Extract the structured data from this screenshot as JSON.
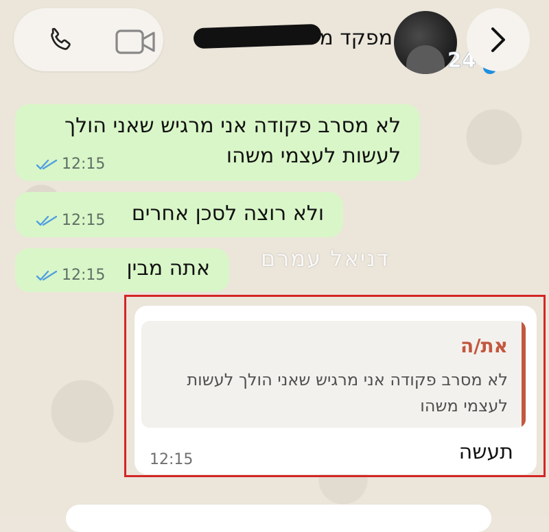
{
  "header": {
    "contact_name": "מפקד מ",
    "call_icon": "phone-icon",
    "video_icon": "video-camera-icon",
    "back_icon": "chevron-right-icon",
    "logo_text": "24"
  },
  "messages": [
    {
      "lines": [
        "לא מסרב פקודה אני מרגיש שאני הולך",
        "לעשות לעצמי משהו"
      ],
      "time": "12:15",
      "status": "read"
    },
    {
      "lines": [
        "ולא רוצה לסכן אחרים"
      ],
      "time": "12:15",
      "status": "read"
    },
    {
      "lines": [
        "אתה מבין"
      ],
      "time": "12:15",
      "status": "read"
    }
  ],
  "watermark": "דניאל עמרם",
  "reply": {
    "quoted_author": "את/ה",
    "quoted_lines": [
      "לא מסרב פקודה אני מרגיש שאני הולך לעשות",
      "לעצמי משהו"
    ],
    "text": "תעשה",
    "time": "12:15"
  },
  "colors": {
    "outgoing_bubble": "#d9f6c8",
    "incoming_bubble": "#ffffff",
    "quote_accent": "#c2583f",
    "read_ticks": "#4f9fe0",
    "highlight_border": "#d32525"
  }
}
